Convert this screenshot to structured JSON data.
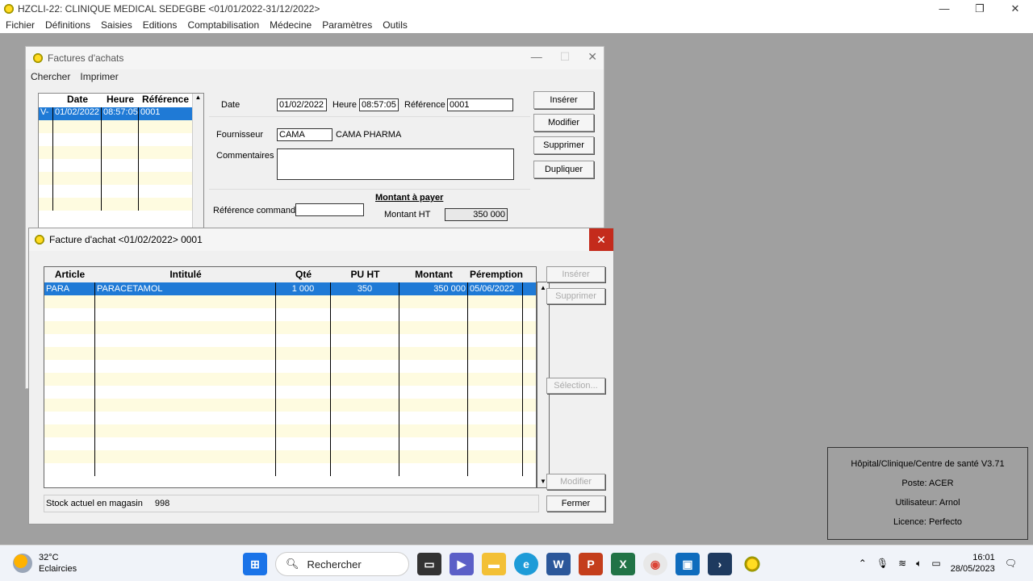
{
  "app": {
    "title": "HZCLI-22: CLINIQUE MEDICAL SEDEGBE <01/01/2022-31/12/2022>",
    "menu": [
      "Fichier",
      "Définitions",
      "Saisies",
      "Editions",
      "Comptabilisation",
      "Médecine",
      "Paramètres",
      "Outils"
    ]
  },
  "factures": {
    "title": "Factures d'achats",
    "menu": [
      "Chercher",
      "Imprimer"
    ],
    "list": {
      "headers": [
        "Date",
        "Heure",
        "Référence"
      ],
      "rows": [
        {
          "flag": "V-",
          "date": "01/02/2022",
          "heure": "08:57:05",
          "ref": "0001"
        }
      ]
    },
    "form": {
      "date_label": "Date",
      "date_value": "01/02/2022",
      "heure_label": "Heure",
      "heure_value": "08:57:05",
      "reference_label": "Référence",
      "reference_value": "0001",
      "fournisseur_label": "Fournisseur",
      "fournisseur_code": "CAMA",
      "fournisseur_name": "CAMA PHARMA",
      "commentaires_label": "Commentaires",
      "commentaires_value": "",
      "ref_commande_label": "Référence commande",
      "ref_commande_value": "",
      "montant_title": "Montant à payer",
      "montant_ht_label": "Montant HT",
      "montant_ht_value": "350 000"
    },
    "buttons": {
      "inserer": "Insérer",
      "modifier": "Modifier",
      "supprimer": "Supprimer",
      "dupliquer": "Dupliquer"
    }
  },
  "dialog": {
    "title": "Facture d'achat <01/02/2022> 0001",
    "grid": {
      "headers": [
        "Article",
        "Intitulé",
        "Qté",
        "PU HT",
        "Montant",
        "Péremption"
      ],
      "rows": [
        {
          "article": "PARA",
          "intitule": "PARACETAMOL",
          "qte": "1 000",
          "pu": "350",
          "montant": "350 000",
          "peremption": "05/06/2022"
        }
      ]
    },
    "stock_label": "Stock actuel en magasin",
    "stock_value": "998",
    "buttons": {
      "inserer": "Insérer",
      "supprimer": "Supprimer",
      "selection": "Sélection...",
      "modifier": "Modifier",
      "fermer": "Fermer"
    }
  },
  "info": {
    "version": "Hôpital/Clinique/Centre de santé V3.71",
    "poste": "Poste:  ACER",
    "utilisateur": "Utilisateur:  Arnol",
    "licence": "Licence: Perfecto"
  },
  "taskbar": {
    "temp": "32°C",
    "weather": "Eclaircies",
    "search": "Rechercher",
    "time": "16:01",
    "date": "28/05/2023"
  }
}
